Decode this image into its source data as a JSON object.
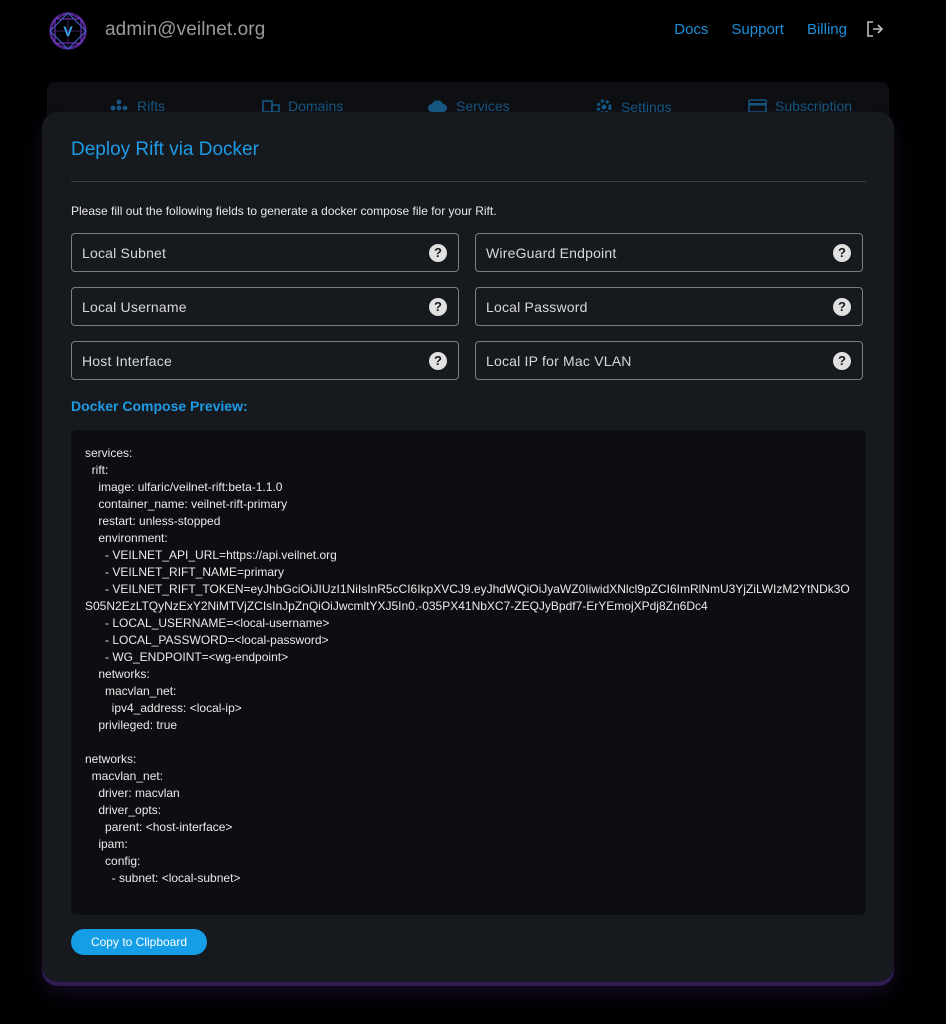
{
  "header": {
    "account": "admin@veilnet.org",
    "links": [
      "Docs",
      "Support",
      "Billing"
    ]
  },
  "tabs": [
    {
      "label": "Rifts",
      "icon": "rifts-icon"
    },
    {
      "label": "Domains",
      "icon": "domains-icon"
    },
    {
      "label": "Services",
      "icon": "cloud-icon"
    },
    {
      "label": "Settings",
      "icon": "gear-icon"
    },
    {
      "label": "Subscription",
      "icon": "card-icon"
    }
  ],
  "dialog": {
    "title": "Deploy Rift via Docker",
    "description": "Please fill out the following fields to generate a docker compose file for your Rift.",
    "fields": [
      {
        "label": "Local Subnet",
        "help": "?"
      },
      {
        "label": "WireGuard Endpoint",
        "help": "?"
      },
      {
        "label": "Local Username",
        "help": "?"
      },
      {
        "label": "Local Password",
        "help": "?"
      },
      {
        "label": "Host Interface",
        "help": "?"
      },
      {
        "label": "Local IP for Mac VLAN",
        "help": "?"
      }
    ],
    "preview_label": "Docker Compose Preview:",
    "code": "services:\n  rift:\n    image: ulfaric/veilnet-rift:beta-1.1.0\n    container_name: veilnet-rift-primary\n    restart: unless-stopped\n    environment:\n      - VEILNET_API_URL=https://api.veilnet.org\n      - VEILNET_RIFT_NAME=primary\n      - VEILNET_RIFT_TOKEN=eyJhbGciOiJIUzI1NiIsInR5cCI6IkpXVCJ9.eyJhdWQiOiJyaWZ0IiwidXNlcl9pZCI6ImRlNmU3YjZiLWIzM2YtNDk3OS05N2EzLTQyNzExY2NiMTVjZCIsInJpZnQiOiJwcmltYXJ5In0.-035PX41NbXC7-ZEQJyBpdf7-ErYEmojXPdj8Zn6Dc4\n      - LOCAL_USERNAME=<local-username>\n      - LOCAL_PASSWORD=<local-password>\n      - WG_ENDPOINT=<wg-endpoint>\n    networks:\n      macvlan_net:\n        ipv4_address: <local-ip>\n    privileged: true\n\nnetworks:\n  macvlan_net:\n    driver: macvlan\n    driver_opts:\n      parent: <host-interface>\n    ipam:\n      config:\n        - subnet: <local-subnet>",
    "copy_button": "Copy to Clipboard"
  },
  "colors": {
    "accent": "#1e9be6",
    "button": "#159ee6",
    "background": "#000000",
    "card": "#16191d"
  }
}
